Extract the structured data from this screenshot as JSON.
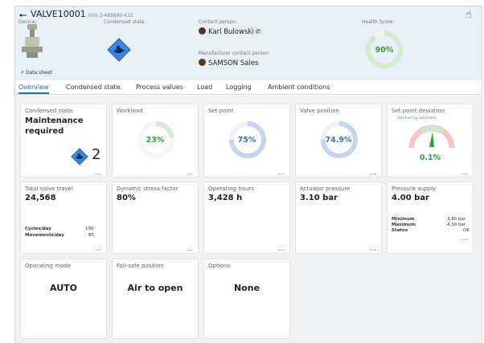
{
  "device": {
    "name": "VALVE10001",
    "serial": "000-3-488890-K32",
    "device_label": "Device:",
    "datasheet": "Data sheet",
    "condensed_label": "Condensed state",
    "contact_label": "Contact person:",
    "contact_name": "Karl Bulowski",
    "manufacturer_label": "Manufacturer contact person",
    "manufacturer_name": "SAMSON Sales",
    "health_label": "Health Score:",
    "health_value": "90%",
    "health_fraction": 0.9
  },
  "tabs": [
    "Overview",
    "Condensed state",
    "Process values",
    "Load",
    "Logging",
    "Ambient conditions"
  ],
  "cards": {
    "condensed": {
      "title": "Condensed state",
      "value": "Maintenance required",
      "count": "2"
    },
    "workload": {
      "title": "Workload",
      "value": "23%",
      "fraction": 0.23
    },
    "setpoint": {
      "title": "Set point",
      "value": "75%",
      "fraction": 0.75
    },
    "valvepos": {
      "title": "Valve position",
      "value": "74.9%",
      "fraction": 0.749
    },
    "deviation": {
      "title": "Set point deviation",
      "note": "2h chart by ws/charts",
      "value": "0.1%"
    },
    "travel": {
      "title": "Total valve travel",
      "value": "24,568",
      "rows": [
        [
          "Cycles/day",
          "190"
        ],
        [
          "Movements/day",
          "85"
        ]
      ]
    },
    "stress": {
      "title": "Dynamic stress factor",
      "value": "80%"
    },
    "hours": {
      "title": "Operating hours",
      "value": "3,428 h"
    },
    "actuator": {
      "title": "Actuator pressure",
      "value": "3.10 bar"
    },
    "supply": {
      "title": "Pressure supply",
      "value": "4.00 bar",
      "rows": [
        [
          "Minimum",
          "3,80 bar"
        ],
        [
          "Maximum",
          "4,30 bar"
        ],
        [
          "Status",
          "OK"
        ]
      ]
    },
    "mode": {
      "title": "Operating mode",
      "value": "AUTO"
    },
    "failsafe": {
      "title": "Fail-safe position",
      "value": "Air to open"
    },
    "options": {
      "title": "Options",
      "value": "None"
    }
  },
  "more": "...",
  "colors": {
    "accent": "#2a6fb5",
    "good": "#2e9e3e",
    "gauge_blue": "#8aaad8",
    "gauge_track": "#dde4ef",
    "diamond": "#3c86d6"
  }
}
